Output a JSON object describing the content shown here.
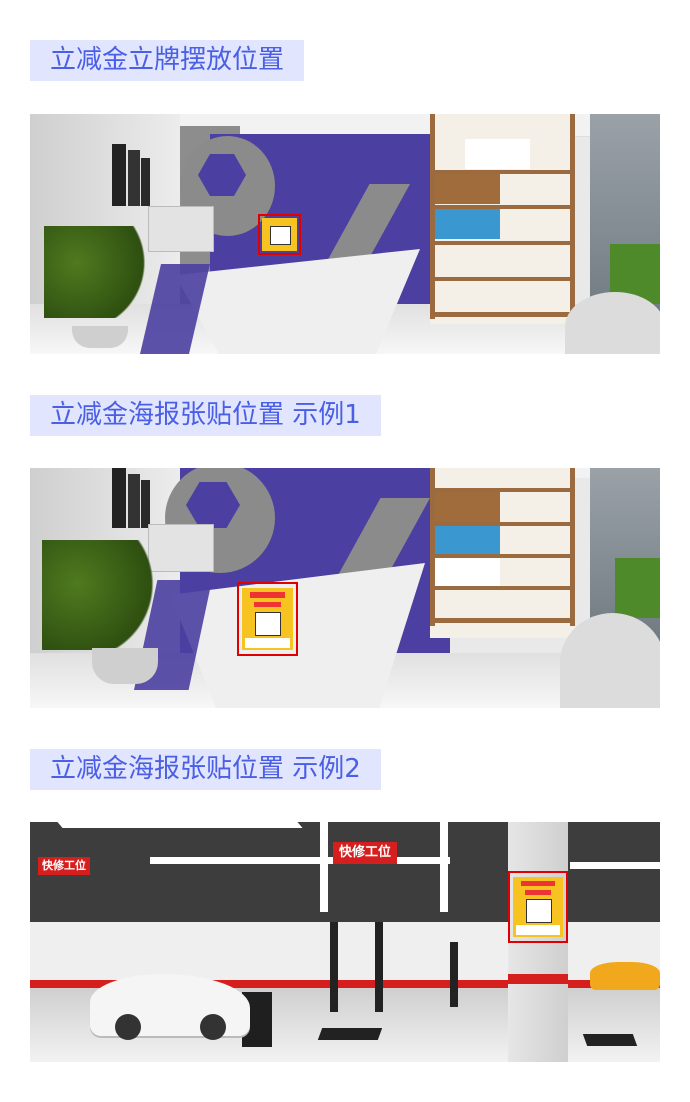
{
  "sections": [
    {
      "title": "立减金立牌摆放位置"
    },
    {
      "title": "立减金海报张贴位置 示例1"
    },
    {
      "title": "立减金海报张贴位置 示例2"
    }
  ],
  "scene3": {
    "sign_label": "快修工位"
  },
  "colors": {
    "title_bg": "#e1e5fd",
    "title_text": "#4a5fe6",
    "highlight": "#e00000",
    "wall_purple": "#4b3fa1",
    "poster_yellow": "#f6c321"
  }
}
